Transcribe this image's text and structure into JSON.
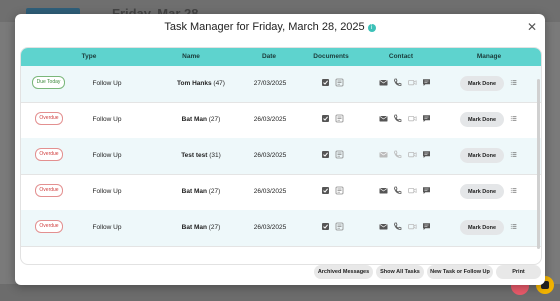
{
  "background": {
    "title_text": "Friday, Mar 28"
  },
  "modal": {
    "title": "Task Manager for Friday, March 28, 2025",
    "columns": [
      "Type",
      "Name",
      "Date",
      "Documents",
      "Contact",
      "Manage"
    ],
    "rows": [
      {
        "badge": "Due Today",
        "status": "due",
        "type": "Follow Up",
        "name": "Tom Hanks",
        "age": "(47)",
        "date": "27/03/2025",
        "mark_done": "Mark Done",
        "contact_dim": false
      },
      {
        "badge": "Overdue",
        "status": "overdue",
        "type": "Follow Up",
        "name": "Bat Man",
        "age": "(27)",
        "date": "26/03/2025",
        "mark_done": "Mark Done",
        "contact_dim": false
      },
      {
        "badge": "Overdue",
        "status": "overdue",
        "type": "Follow Up",
        "name": "Test test",
        "age": "(31)",
        "date": "26/03/2025",
        "mark_done": "Mark Done",
        "contact_dim": true
      },
      {
        "badge": "Overdue",
        "status": "overdue",
        "type": "Follow Up",
        "name": "Bat Man",
        "age": "(27)",
        "date": "26/03/2025",
        "mark_done": "Mark Done",
        "contact_dim": false
      },
      {
        "badge": "Overdue",
        "status": "overdue",
        "type": "Follow Up",
        "name": "Bat Man",
        "age": "(27)",
        "date": "26/03/2025",
        "mark_done": "Mark Done",
        "contact_dim": false
      }
    ],
    "footer": {
      "archived": "Archived Messages",
      "show_all": "Show All Tasks",
      "new_task": "New Task or Follow Up",
      "print": "Print"
    }
  },
  "colors": {
    "header_teal": "#5ed3ce",
    "due_green": "#3d8a3d",
    "overdue_red": "#d14040"
  },
  "icons": {
    "documents": [
      "checkbox-icon",
      "notes-icon"
    ],
    "contact": [
      "email-icon",
      "phone-icon",
      "video-icon",
      "chat-icon"
    ],
    "manage": [
      "list-icon"
    ]
  }
}
